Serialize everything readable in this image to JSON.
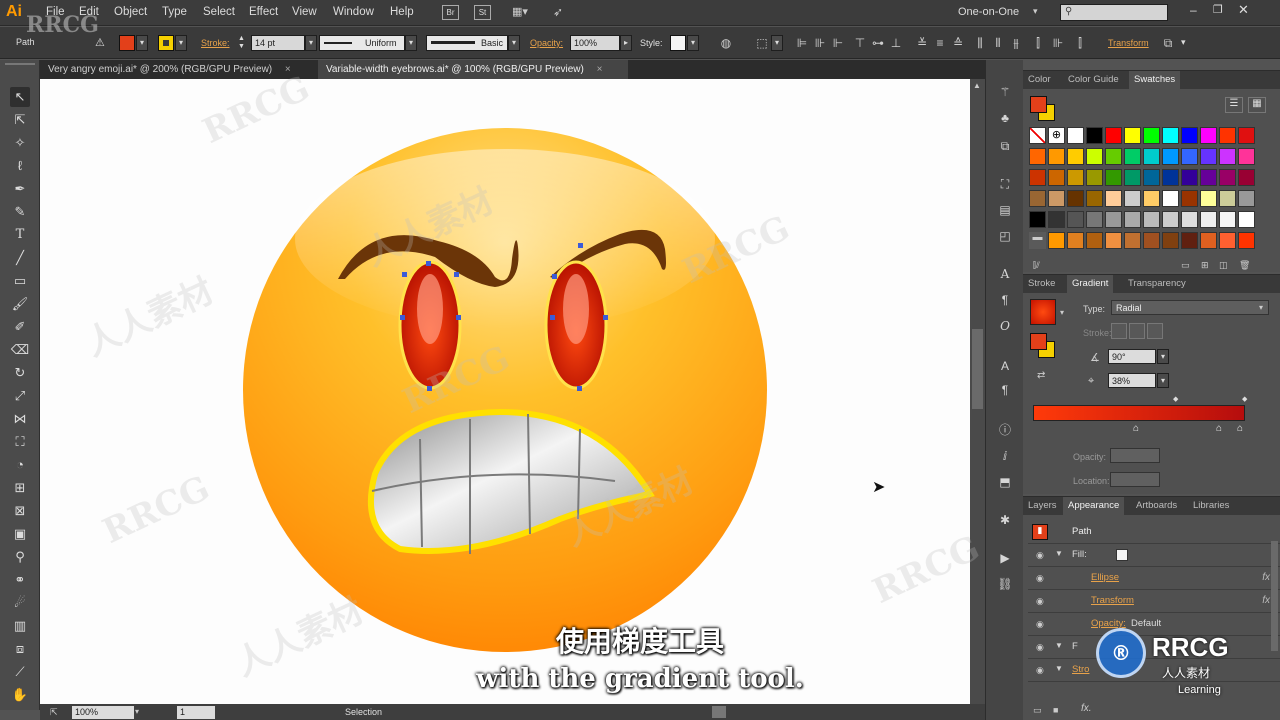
{
  "app": {
    "logo": "Ai",
    "workspace": "One-on-One",
    "menu": [
      "File",
      "Edit",
      "Object",
      "Type",
      "Select",
      "Effect",
      "View",
      "Window",
      "Help"
    ],
    "menu_buttons": [
      "Br",
      "St"
    ]
  },
  "control_bar": {
    "selection_type": "Path",
    "fill_color": "#e3401a",
    "stroke_color": "#f5d000",
    "stroke_label": "Stroke:",
    "stroke_weight": "14 pt",
    "profile": "Uniform",
    "brush": "Basic",
    "opacity_label": "Opacity:",
    "opacity": "100%",
    "style_label": "Style:",
    "transform_label": "Transform"
  },
  "document_tabs": [
    {
      "title": "Very angry emoji.ai* @ 200% (RGB/GPU Preview)",
      "close": "×"
    },
    {
      "title": "Variable-width eyebrows.ai* @ 100% (RGB/GPU Preview)",
      "close": "×"
    }
  ],
  "status_bar": {
    "zoom": "100%",
    "artboard": "1",
    "mode": "Selection"
  },
  "swatches_panel": {
    "tabs": [
      "Color",
      "Color Guide",
      "Swatches"
    ],
    "active_tab": "Swatches",
    "fill_color": "#e3401a",
    "stroke_color": "#f5d000",
    "rows": [
      [
        "none",
        "reg",
        "#ffffff",
        "#000000",
        "#ff0000",
        "#ffff00",
        "#00ff00",
        "#00ffff",
        "#0000ff",
        "#ff00ff",
        "#ff3300",
        "#e01010"
      ],
      [
        "#ff6600",
        "#ff9900",
        "#ffcc00",
        "#ccff00",
        "#66cc00",
        "#00cc66",
        "#00cccc",
        "#0099ff",
        "#3366ff",
        "#6633ff",
        "#cc33ff",
        "#ff3399"
      ],
      [
        "#cc3300",
        "#cc6600",
        "#cc9900",
        "#999900",
        "#339900",
        "#009966",
        "#006699",
        "#003399",
        "#330099",
        "#660099",
        "#990066",
        "#990033"
      ],
      [
        "#996633",
        "#cc9966",
        "#663300",
        "#996600",
        "#ffcc99",
        "#cccccc",
        "#ffcc66",
        "#ffffff",
        "#993300",
        "#ffff99",
        "#cccc99",
        "#999999"
      ],
      [
        "#000000",
        "#333333",
        "#555555",
        "#777777",
        "#999999",
        "#aaaaaa",
        "#bbbbbb",
        "#cccccc",
        "#dddddd",
        "#eeeeee",
        "#f5f5f5",
        "#ffffff"
      ],
      [
        "folder",
        "#ff9900",
        "#e08020",
        "#b06010",
        "#f09040",
        "#c07030",
        "#a05020",
        "#804010",
        "#602010",
        "#e06020",
        "#ff6030",
        "#ff3300"
      ]
    ]
  },
  "gradient_panel": {
    "tabs": [
      "Stroke",
      "Gradient",
      "Transparency"
    ],
    "active_tab": "Gradient",
    "type_label": "Type:",
    "type": "Radial",
    "stroke_label": "Stroke:",
    "angle": "90°",
    "aspect_ratio": "38%",
    "opacity_label": "Opacity:",
    "location_label": "Location:",
    "ramp_start": "#ff3a0a",
    "ramp_end": "#b50d0d"
  },
  "appearance_panel": {
    "tabs": [
      "Layers",
      "Appearance",
      "Artboards",
      "Libraries"
    ],
    "active_tab": "Appearance",
    "object": "Path",
    "rows": [
      {
        "label": "Fill:",
        "kind": "fill"
      },
      {
        "label": "Ellipse",
        "kind": "effect",
        "fx": "fx"
      },
      {
        "label": "Transform",
        "kind": "effect",
        "fx": "fx"
      },
      {
        "label": "Opacity:",
        "value": "Default",
        "kind": "opacity"
      },
      {
        "label": "F",
        "kind": "fill2"
      },
      {
        "label": "Stro",
        "kind": "stroke"
      }
    ],
    "footer_fx": "fx."
  },
  "subtitle": {
    "chinese": "使用梯度工具",
    "english": "with the gradient tool."
  },
  "watermark": {
    "brand": "RRCG",
    "cn": "人人素材",
    "badge_cn": "人人素材",
    "badge_en": "Learning"
  }
}
